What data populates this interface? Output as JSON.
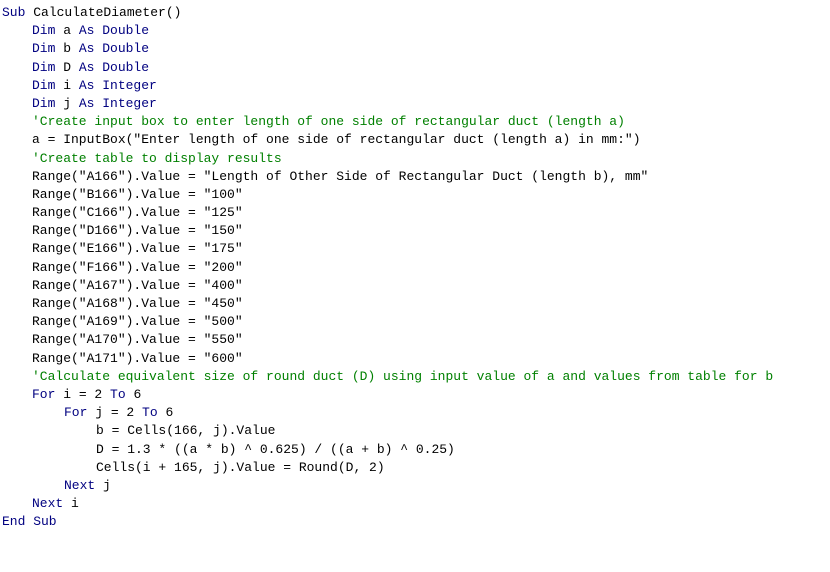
{
  "lines": [
    {
      "indent": 0,
      "segments": [
        {
          "class": "kw",
          "text": "Sub "
        },
        {
          "class": "txt",
          "text": "CalculateDiameter()"
        }
      ]
    },
    {
      "indent": 0,
      "segments": [
        {
          "class": "txt",
          "text": ""
        }
      ]
    },
    {
      "indent": 1,
      "segments": [
        {
          "class": "kw",
          "text": "Dim "
        },
        {
          "class": "txt",
          "text": "a "
        },
        {
          "class": "kw",
          "text": "As Double"
        }
      ]
    },
    {
      "indent": 1,
      "segments": [
        {
          "class": "kw",
          "text": "Dim "
        },
        {
          "class": "txt",
          "text": "b "
        },
        {
          "class": "kw",
          "text": "As Double"
        }
      ]
    },
    {
      "indent": 1,
      "segments": [
        {
          "class": "kw",
          "text": "Dim "
        },
        {
          "class": "txt",
          "text": "D "
        },
        {
          "class": "kw",
          "text": "As Double"
        }
      ]
    },
    {
      "indent": 1,
      "segments": [
        {
          "class": "kw",
          "text": "Dim "
        },
        {
          "class": "txt",
          "text": "i "
        },
        {
          "class": "kw",
          "text": "As Integer"
        }
      ]
    },
    {
      "indent": 1,
      "segments": [
        {
          "class": "kw",
          "text": "Dim "
        },
        {
          "class": "txt",
          "text": "j "
        },
        {
          "class": "kw",
          "text": "As Integer"
        }
      ]
    },
    {
      "indent": 0,
      "segments": [
        {
          "class": "txt",
          "text": ""
        }
      ]
    },
    {
      "indent": 1,
      "segments": [
        {
          "class": "comment",
          "text": "'Create input box to enter length of one side of rectangular duct (length a)"
        }
      ]
    },
    {
      "indent": 1,
      "segments": [
        {
          "class": "txt",
          "text": "a = InputBox(\"Enter length of one side of rectangular duct (length a) in mm:\")"
        }
      ]
    },
    {
      "indent": 0,
      "segments": [
        {
          "class": "txt",
          "text": ""
        }
      ]
    },
    {
      "indent": 1,
      "segments": [
        {
          "class": "comment",
          "text": "'Create table to display results"
        }
      ]
    },
    {
      "indent": 1,
      "segments": [
        {
          "class": "txt",
          "text": "Range(\"A166\").Value = \"Length of Other Side of Rectangular Duct (length b), mm\""
        }
      ]
    },
    {
      "indent": 1,
      "segments": [
        {
          "class": "txt",
          "text": "Range(\"B166\").Value = \"100\""
        }
      ]
    },
    {
      "indent": 1,
      "segments": [
        {
          "class": "txt",
          "text": "Range(\"C166\").Value = \"125\""
        }
      ]
    },
    {
      "indent": 1,
      "segments": [
        {
          "class": "txt",
          "text": "Range(\"D166\").Value = \"150\""
        }
      ]
    },
    {
      "indent": 1,
      "segments": [
        {
          "class": "txt",
          "text": "Range(\"E166\").Value = \"175\""
        }
      ]
    },
    {
      "indent": 1,
      "segments": [
        {
          "class": "txt",
          "text": "Range(\"F166\").Value = \"200\""
        }
      ]
    },
    {
      "indent": 0,
      "segments": [
        {
          "class": "txt",
          "text": ""
        }
      ]
    },
    {
      "indent": 1,
      "segments": [
        {
          "class": "txt",
          "text": "Range(\"A167\").Value = \"400\""
        }
      ]
    },
    {
      "indent": 1,
      "segments": [
        {
          "class": "txt",
          "text": "Range(\"A168\").Value = \"450\""
        }
      ]
    },
    {
      "indent": 1,
      "segments": [
        {
          "class": "txt",
          "text": "Range(\"A169\").Value = \"500\""
        }
      ]
    },
    {
      "indent": 1,
      "segments": [
        {
          "class": "txt",
          "text": "Range(\"A170\").Value = \"550\""
        }
      ]
    },
    {
      "indent": 1,
      "segments": [
        {
          "class": "txt",
          "text": "Range(\"A171\").Value = \"600\""
        }
      ]
    },
    {
      "indent": 0,
      "segments": [
        {
          "class": "txt",
          "text": ""
        }
      ]
    },
    {
      "indent": 1,
      "segments": [
        {
          "class": "comment",
          "text": "'Calculate equivalent size of round duct (D) using input value of a and values from table for b"
        }
      ]
    },
    {
      "indent": 1,
      "segments": [
        {
          "class": "kw",
          "text": "For "
        },
        {
          "class": "txt",
          "text": "i = 2 "
        },
        {
          "class": "kw",
          "text": "To "
        },
        {
          "class": "txt",
          "text": "6"
        }
      ]
    },
    {
      "indent": 2,
      "segments": [
        {
          "class": "kw",
          "text": "For "
        },
        {
          "class": "txt",
          "text": "j = 2 "
        },
        {
          "class": "kw",
          "text": "To "
        },
        {
          "class": "txt",
          "text": "6"
        }
      ]
    },
    {
      "indent": 3,
      "segments": [
        {
          "class": "txt",
          "text": "b = Cells(166, j).Value"
        }
      ]
    },
    {
      "indent": 3,
      "segments": [
        {
          "class": "txt",
          "text": "D = 1.3 * ((a * b) ^ 0.625) / ((a + b) ^ 0.25)"
        }
      ]
    },
    {
      "indent": 3,
      "segments": [
        {
          "class": "txt",
          "text": "Cells(i + 165, j).Value = Round(D, 2)"
        }
      ]
    },
    {
      "indent": 2,
      "segments": [
        {
          "class": "kw",
          "text": "Next "
        },
        {
          "class": "txt",
          "text": "j"
        }
      ]
    },
    {
      "indent": 1,
      "segments": [
        {
          "class": "kw",
          "text": "Next "
        },
        {
          "class": "txt",
          "text": "i"
        }
      ]
    },
    {
      "indent": 0,
      "segments": [
        {
          "class": "txt",
          "text": ""
        }
      ]
    },
    {
      "indent": 0,
      "segments": [
        {
          "class": "kw",
          "text": "End Sub"
        }
      ]
    }
  ]
}
